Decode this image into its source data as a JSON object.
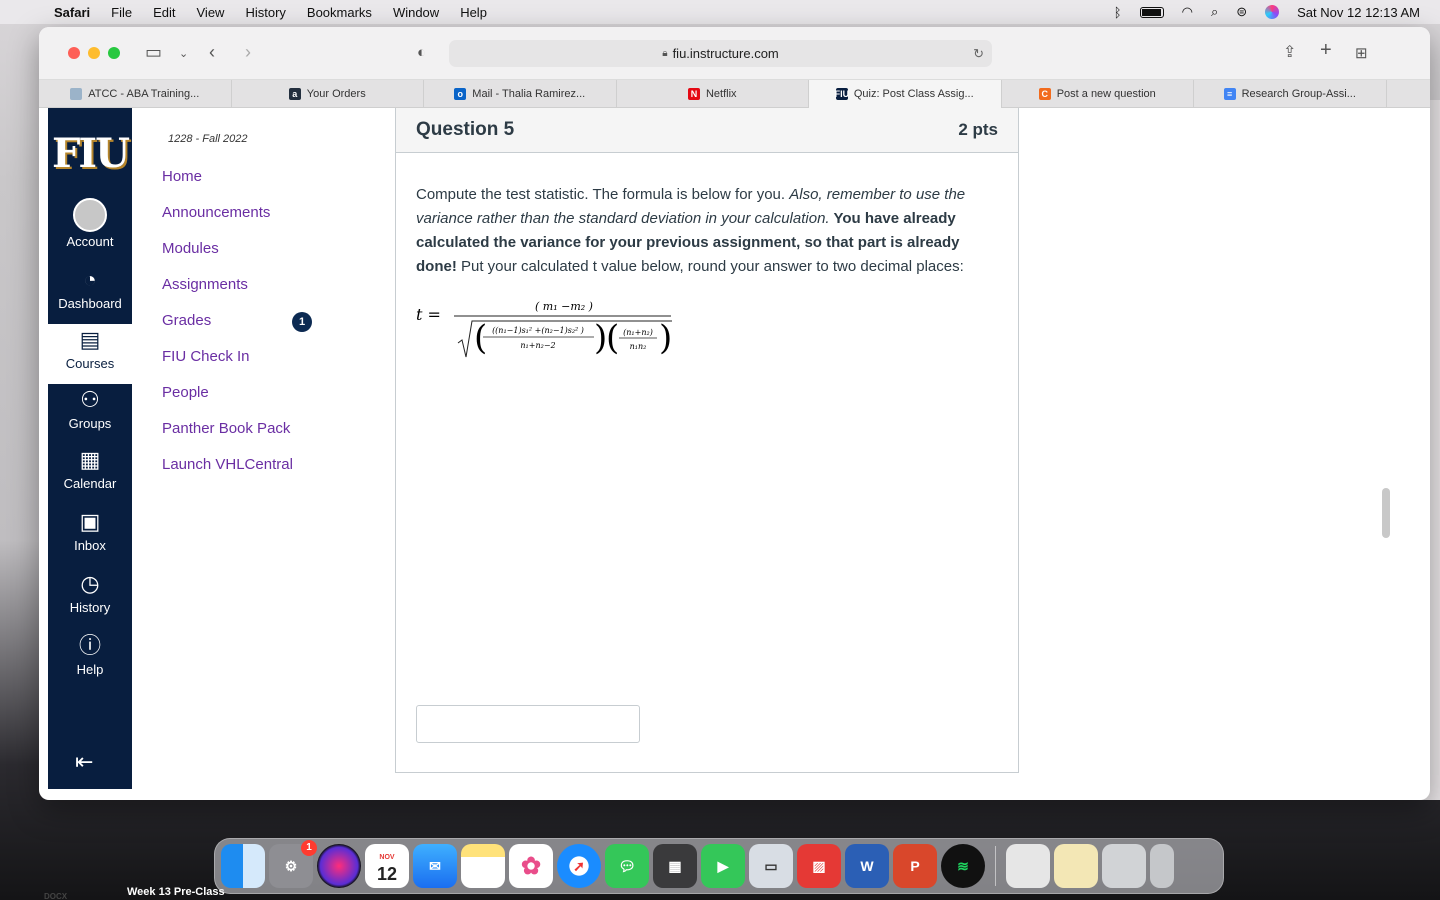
{
  "menubar": {
    "app": "Safari",
    "items": [
      "File",
      "Edit",
      "View",
      "History",
      "Bookmarks",
      "Window",
      "Help"
    ],
    "clock": "Sat Nov 12  12:13 AM"
  },
  "browser": {
    "url": "fiu.instructure.com",
    "tabs": [
      {
        "label": "ATCC - ABA Training...",
        "fav": "",
        "color": "#9bb3c9"
      },
      {
        "label": "Your Orders",
        "fav": "a",
        "color": "#232f3e"
      },
      {
        "label": "Mail - Thalia Ramirez...",
        "fav": "o",
        "color": "#0a64c8"
      },
      {
        "label": "Netflix",
        "fav": "N",
        "color": "#e50914"
      },
      {
        "label": "Quiz: Post Class Assig...",
        "fav": "FIU",
        "color": "#081e3f"
      },
      {
        "label": "Post a new question",
        "fav": "C",
        "color": "#f26b1d"
      },
      {
        "label": "Research Group-Assi...",
        "fav": "≡",
        "color": "#4285f4"
      }
    ]
  },
  "global_nav": {
    "logo": "FIU",
    "items": [
      {
        "label": "Account",
        "icon": "account-icon"
      },
      {
        "label": "Dashboard",
        "icon": "dashboard-icon"
      },
      {
        "label": "Courses",
        "icon": "courses-icon"
      },
      {
        "label": "Groups",
        "icon": "groups-icon"
      },
      {
        "label": "Calendar",
        "icon": "calendar-icon"
      },
      {
        "label": "Inbox",
        "icon": "inbox-icon"
      },
      {
        "label": "History",
        "icon": "history-icon"
      },
      {
        "label": "Help",
        "icon": "help-icon"
      }
    ]
  },
  "course_nav": {
    "term": "1228 - Fall 2022",
    "items": [
      "Home",
      "Announcements",
      "Modules",
      "Assignments",
      "Grades",
      "FIU Check In",
      "People",
      "Panther Book Pack",
      "Launch VHLCentral"
    ],
    "grades_badge": "1"
  },
  "question": {
    "title": "Question 5",
    "points": "2 pts",
    "text_1": "Compute the test statistic. The formula is below for you. ",
    "text_2_italic": "Also, remember to use the variance rather than the standard deviation in your calculation.",
    "text_3_bold": " You have already calculated the variance for your previous assignment, so that part is already done!",
    "text_4": " Put your calculated t value below, round your answer to two decimal places:",
    "formula": {
      "lhs": "t =",
      "numerator": "( m₁ −m₂ )",
      "den_a_num": "((n₁−1)s₁² +(n₂−1)s₂² )",
      "den_a_den": "n₁+n₂−2",
      "den_b_num": "(n₁+n₂)",
      "den_b_den": "n₁n₂"
    },
    "answer_value": ""
  },
  "desktop": {
    "file_label": "Week 13 Pre-Class",
    "docx_label": "DOCX"
  },
  "dock": {
    "calendar_month": "NOV",
    "calendar_day": "12",
    "settings_badge": "1"
  }
}
